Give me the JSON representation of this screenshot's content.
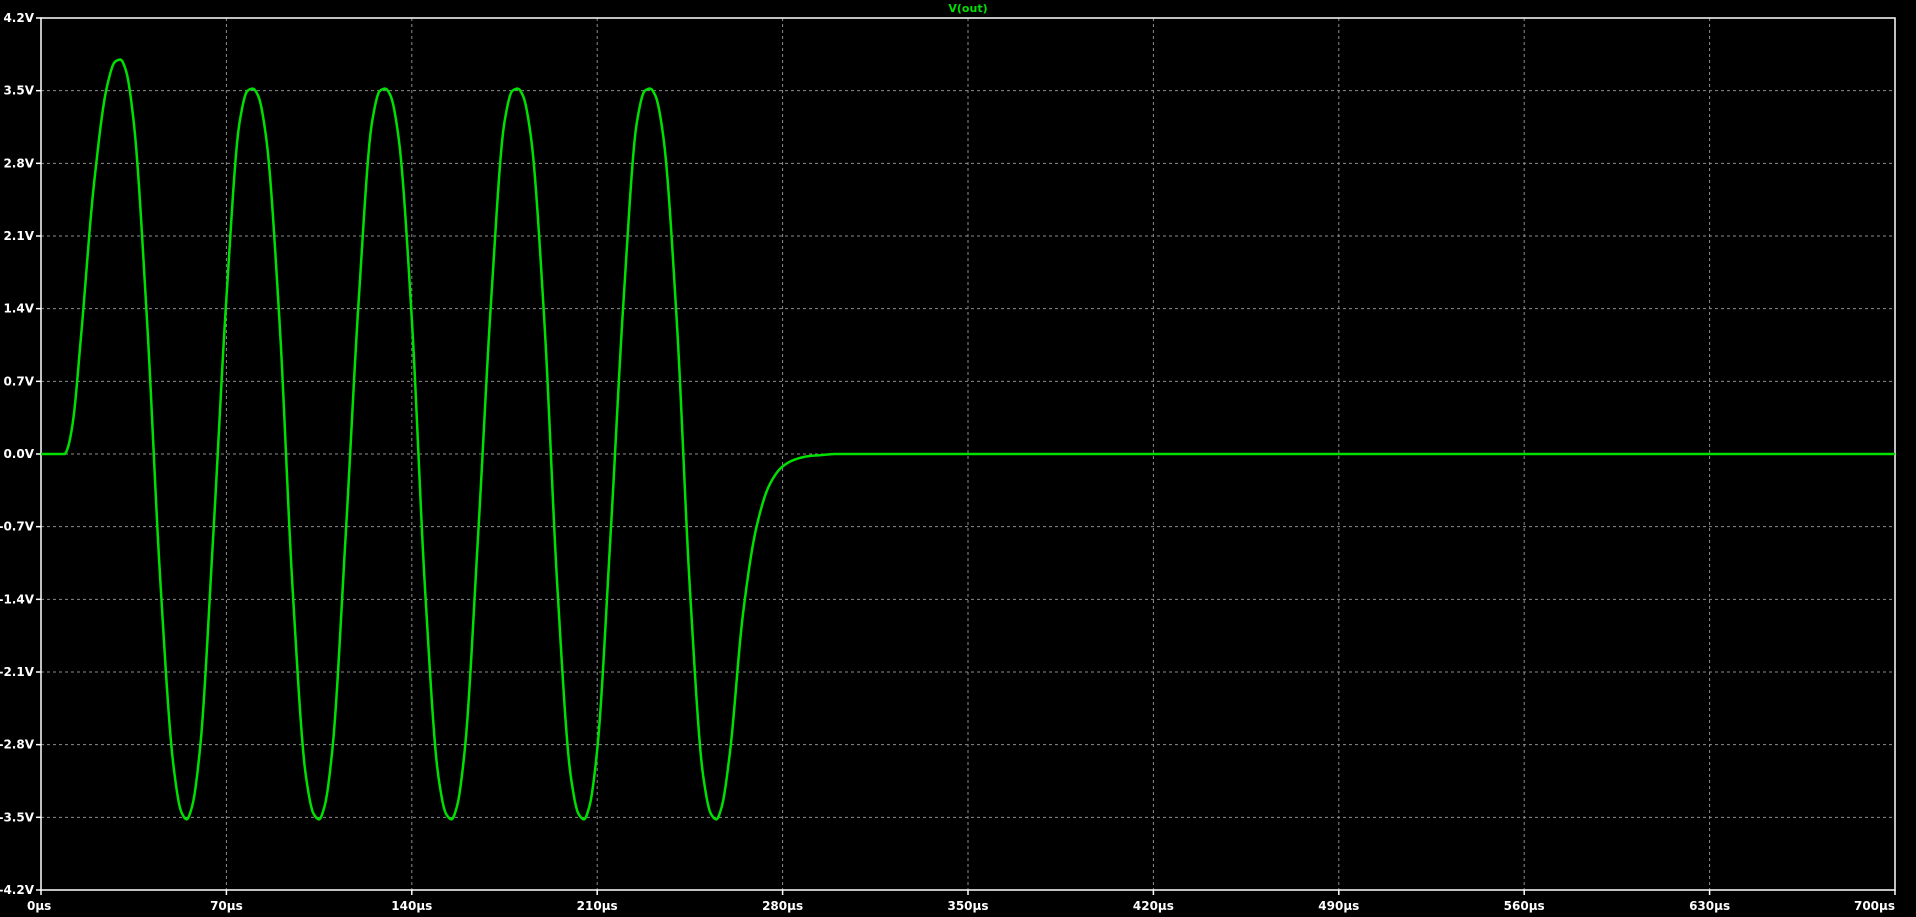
{
  "chart_data": {
    "type": "line",
    "title": "V(out)",
    "x_unit": "µs",
    "y_unit": "V",
    "xlim": [
      0,
      700
    ],
    "ylim": [
      -4.2,
      4.2
    ],
    "x_ticks": [
      0,
      70,
      140,
      210,
      280,
      350,
      420,
      490,
      560,
      630,
      700
    ],
    "y_ticks": [
      4.2,
      3.5,
      2.8,
      2.1,
      1.4,
      0.7,
      0.0,
      -0.7,
      -1.4,
      -2.1,
      -2.8,
      -3.5,
      -4.2
    ],
    "x_tick_labels": [
      "0µs",
      "70µs",
      "140µs",
      "210µs",
      "280µs",
      "350µs",
      "420µs",
      "490µs",
      "560µs",
      "630µs",
      "700µs"
    ],
    "y_tick_labels": [
      "4.2V",
      "3.5V",
      "2.8V",
      "2.1V",
      "1.4V",
      "0.7V",
      "0.0V",
      "-0.7V",
      "-1.4V",
      "-2.1V",
      "-2.8V",
      "-3.5V",
      "-4.2V"
    ],
    "grid": true,
    "background": "#000000",
    "series": [
      {
        "name": "V(out)",
        "color": "#00e000",
        "x": [
          0,
          9,
          10,
          12,
          15,
          20,
          25,
          28,
          30,
          32,
          35,
          40,
          45,
          50,
          53,
          55,
          57,
          60,
          65,
          70,
          75,
          78,
          80,
          82,
          85,
          90,
          95,
          100,
          103,
          105,
          107,
          110,
          115,
          120,
          125,
          128,
          130,
          132,
          135,
          140,
          145,
          150,
          153,
          155,
          157,
          160,
          165,
          170,
          175,
          178,
          180,
          182,
          185,
          190,
          195,
          200,
          203,
          205,
          207,
          210,
          215,
          220,
          225,
          228,
          230,
          232,
          235,
          240,
          245,
          250,
          253,
          255,
          257,
          260,
          265,
          270,
          275,
          280,
          285,
          290,
          295,
          300,
          310,
          350,
          420,
          490,
          560,
          630,
          700
        ],
        "y": [
          0,
          0,
          0.05,
          0.3,
          1.1,
          2.6,
          3.55,
          3.78,
          3.8,
          3.7,
          3.2,
          1.3,
          -1.2,
          -3.0,
          -3.45,
          -3.52,
          -3.4,
          -2.85,
          -0.8,
          1.5,
          3.2,
          3.5,
          3.52,
          3.45,
          3.05,
          1.3,
          -1.3,
          -3.1,
          -3.47,
          -3.52,
          -3.4,
          -2.85,
          -0.8,
          1.5,
          3.2,
          3.5,
          3.52,
          3.45,
          3.05,
          1.3,
          -1.3,
          -3.1,
          -3.47,
          -3.52,
          -3.4,
          -2.85,
          -0.8,
          1.5,
          3.2,
          3.5,
          3.52,
          3.45,
          3.05,
          1.3,
          -1.3,
          -3.1,
          -3.47,
          -3.52,
          -3.4,
          -2.85,
          -0.8,
          1.5,
          3.2,
          3.5,
          3.52,
          3.45,
          3.05,
          1.3,
          -1.3,
          -3.1,
          -3.47,
          -3.52,
          -3.4,
          -2.9,
          -1.55,
          -0.72,
          -0.3,
          -0.12,
          -0.05,
          -0.02,
          -0.01,
          0,
          0,
          0,
          0,
          0,
          0,
          0,
          0
        ]
      }
    ]
  }
}
